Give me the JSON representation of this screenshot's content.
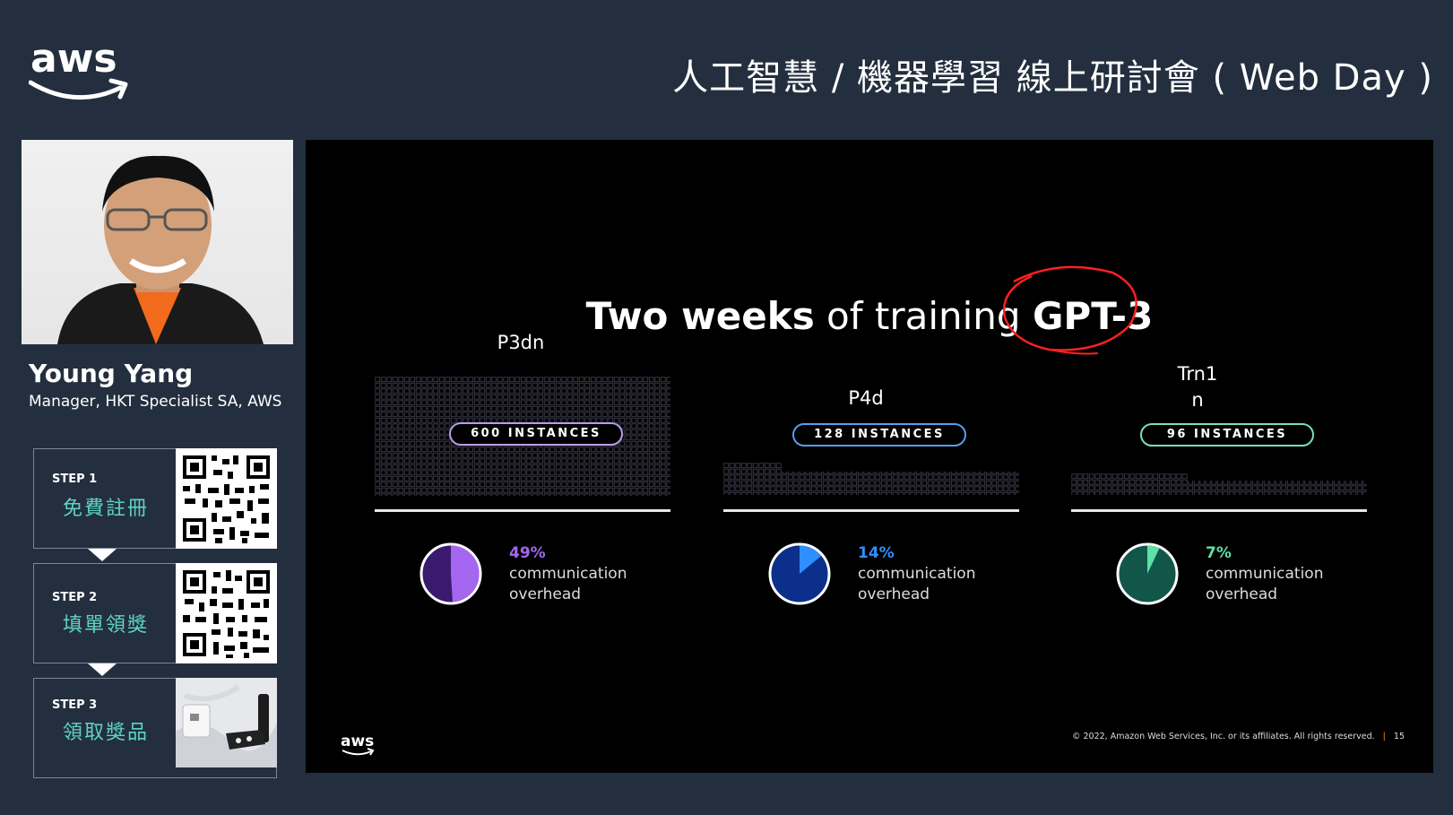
{
  "header": {
    "logo": "aws",
    "title": "人工智慧 / 機器學習 線上研討會 ( Web Day )"
  },
  "speaker": {
    "name": "Young Yang",
    "role": "Manager, HKT Specialist SA, AWS"
  },
  "steps": [
    {
      "label": "STEP 1",
      "text": "免費註冊",
      "image": "qr-code"
    },
    {
      "label": "STEP 2",
      "text": "填單領獎",
      "image": "qr-code"
    },
    {
      "label": "STEP 3",
      "text": "領取獎品",
      "image": "prize-photo"
    }
  ],
  "slide": {
    "title_bold_1": "Two weeks",
    "title_regular": " of training ",
    "title_bold_2": "GPT-3",
    "columns": [
      {
        "name": "P3dn",
        "instances": "600 INSTANCES",
        "percent": "49%",
        "fraction": 0.49,
        "desc_1": "communication",
        "desc_2": "overhead",
        "accent": "#a566f0",
        "dark": "#3a1a6e"
      },
      {
        "name": "P4d",
        "instances": "128 INSTANCES",
        "percent": "14%",
        "fraction": 0.14,
        "desc_1": "communication",
        "desc_2": "overhead",
        "accent": "#2f8fff",
        "dark": "#0b2f8a"
      },
      {
        "name": "Trn1\nn",
        "instances": "96 INSTANCES",
        "percent": "7%",
        "fraction": 0.07,
        "desc_1": "communication",
        "desc_2": "overhead",
        "accent": "#5fe0a8",
        "dark": "#12564a"
      }
    ],
    "logo": "aws",
    "copyright": "© 2022, Amazon Web Services, Inc. or its affiliates. All rights reserved.",
    "page_number": "15"
  }
}
